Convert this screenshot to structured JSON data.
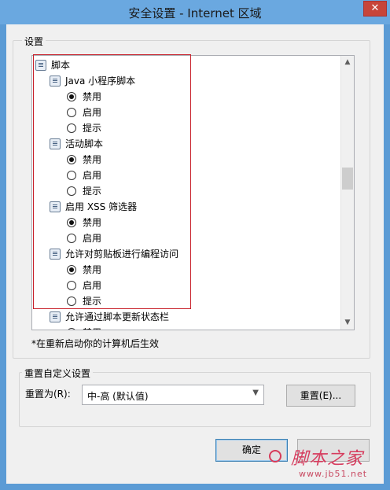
{
  "window": {
    "title": "安全设置 - Internet 区域",
    "close_glyph": "✕"
  },
  "settings_group": {
    "label": "设置"
  },
  "tree": [
    {
      "type": "category",
      "label": "脚本",
      "icon": "script-settings-icon"
    },
    {
      "type": "setting",
      "label": "Java 小程序脚本",
      "icon": "script-settings-icon"
    },
    {
      "type": "option",
      "label": "禁用",
      "checked": true
    },
    {
      "type": "option",
      "label": "启用",
      "checked": false
    },
    {
      "type": "option",
      "label": "提示",
      "checked": false
    },
    {
      "type": "setting",
      "label": "活动脚本",
      "icon": "script-settings-icon"
    },
    {
      "type": "option",
      "label": "禁用",
      "checked": true
    },
    {
      "type": "option",
      "label": "启用",
      "checked": false
    },
    {
      "type": "option",
      "label": "提示",
      "checked": false
    },
    {
      "type": "setting",
      "label": "启用 XSS 筛选器",
      "icon": "script-settings-icon"
    },
    {
      "type": "option",
      "label": "禁用",
      "checked": true
    },
    {
      "type": "option",
      "label": "启用",
      "checked": false
    },
    {
      "type": "setting",
      "label": "允许对剪贴板进行编程访问",
      "icon": "script-settings-icon"
    },
    {
      "type": "option",
      "label": "禁用",
      "checked": true
    },
    {
      "type": "option",
      "label": "启用",
      "checked": false
    },
    {
      "type": "option",
      "label": "提示",
      "checked": false
    },
    {
      "type": "setting",
      "label": "允许通过脚本更新状态栏",
      "icon": "script-settings-icon"
    },
    {
      "type": "option",
      "label": "禁用",
      "checked": true
    }
  ],
  "note": "*在重新启动你的计算机后生效",
  "reset_group": {
    "label": "重置自定义设置",
    "reset_to_label": "重置为(R):",
    "select_value": "中-高 (默认值)",
    "reset_button": "重置(E)..."
  },
  "buttons": {
    "ok": "确定",
    "cancel": ""
  },
  "watermark": {
    "main": "脚本之家",
    "sub": "www.jb51.net"
  },
  "colors": {
    "highlight_border": "#c8202a",
    "title_bar": "#6aa8e0",
    "accent": "#3c7fb1"
  }
}
